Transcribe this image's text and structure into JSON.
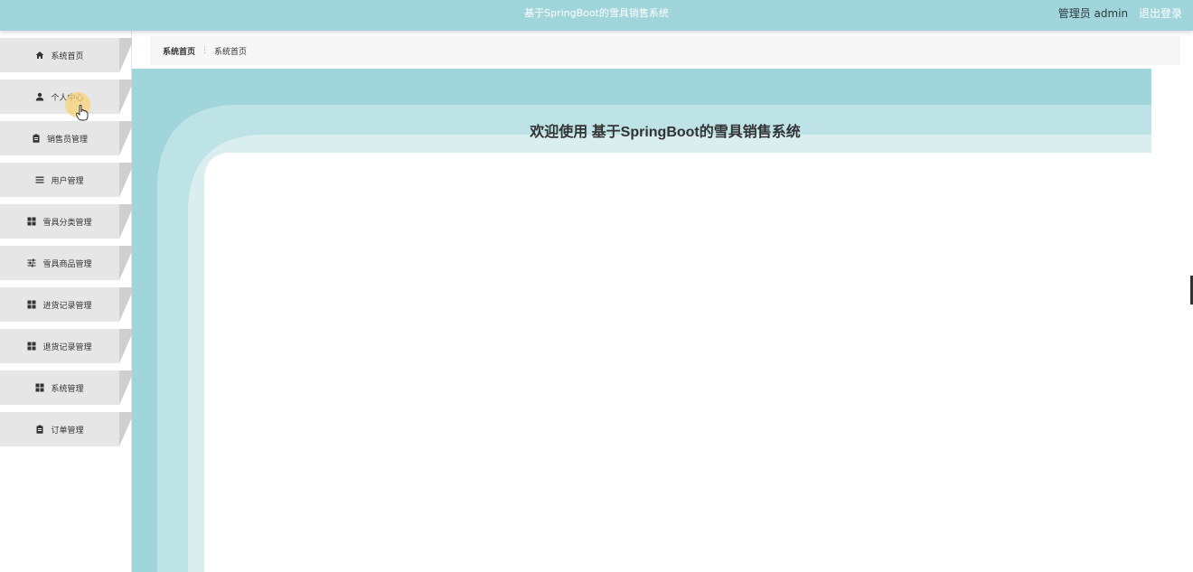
{
  "app": {
    "title": "基于SpringBoot的雪具销售系统"
  },
  "user": {
    "label": "管理员 admin",
    "logout": "退出登录"
  },
  "sidebar": {
    "items": [
      {
        "label": "系统首页",
        "icon": "home-icon"
      },
      {
        "label": "个人中心",
        "icon": "user-icon"
      },
      {
        "label": "销售员管理",
        "icon": "clipboard-icon"
      },
      {
        "label": "用户管理",
        "icon": "list-icon"
      },
      {
        "label": "雪具分类管理",
        "icon": "grid-icon"
      },
      {
        "label": "雪具商品管理",
        "icon": "sliders-icon"
      },
      {
        "label": "进货记录管理",
        "icon": "grid-icon"
      },
      {
        "label": "退货记录管理",
        "icon": "grid-icon"
      },
      {
        "label": "系统管理",
        "icon": "grid-icon"
      },
      {
        "label": "订单管理",
        "icon": "clipboard-icon"
      }
    ]
  },
  "breadcrumb": {
    "home": "系统首页",
    "current": "系统首页"
  },
  "main": {
    "welcome": "欢迎使用 基于SpringBoot的雪具销售系统"
  },
  "colors": {
    "accent": "#9fd5db",
    "accent_light": "#bee3e7",
    "accent_lighter": "#daeef0",
    "menu_bg": "#e8e8e8"
  }
}
